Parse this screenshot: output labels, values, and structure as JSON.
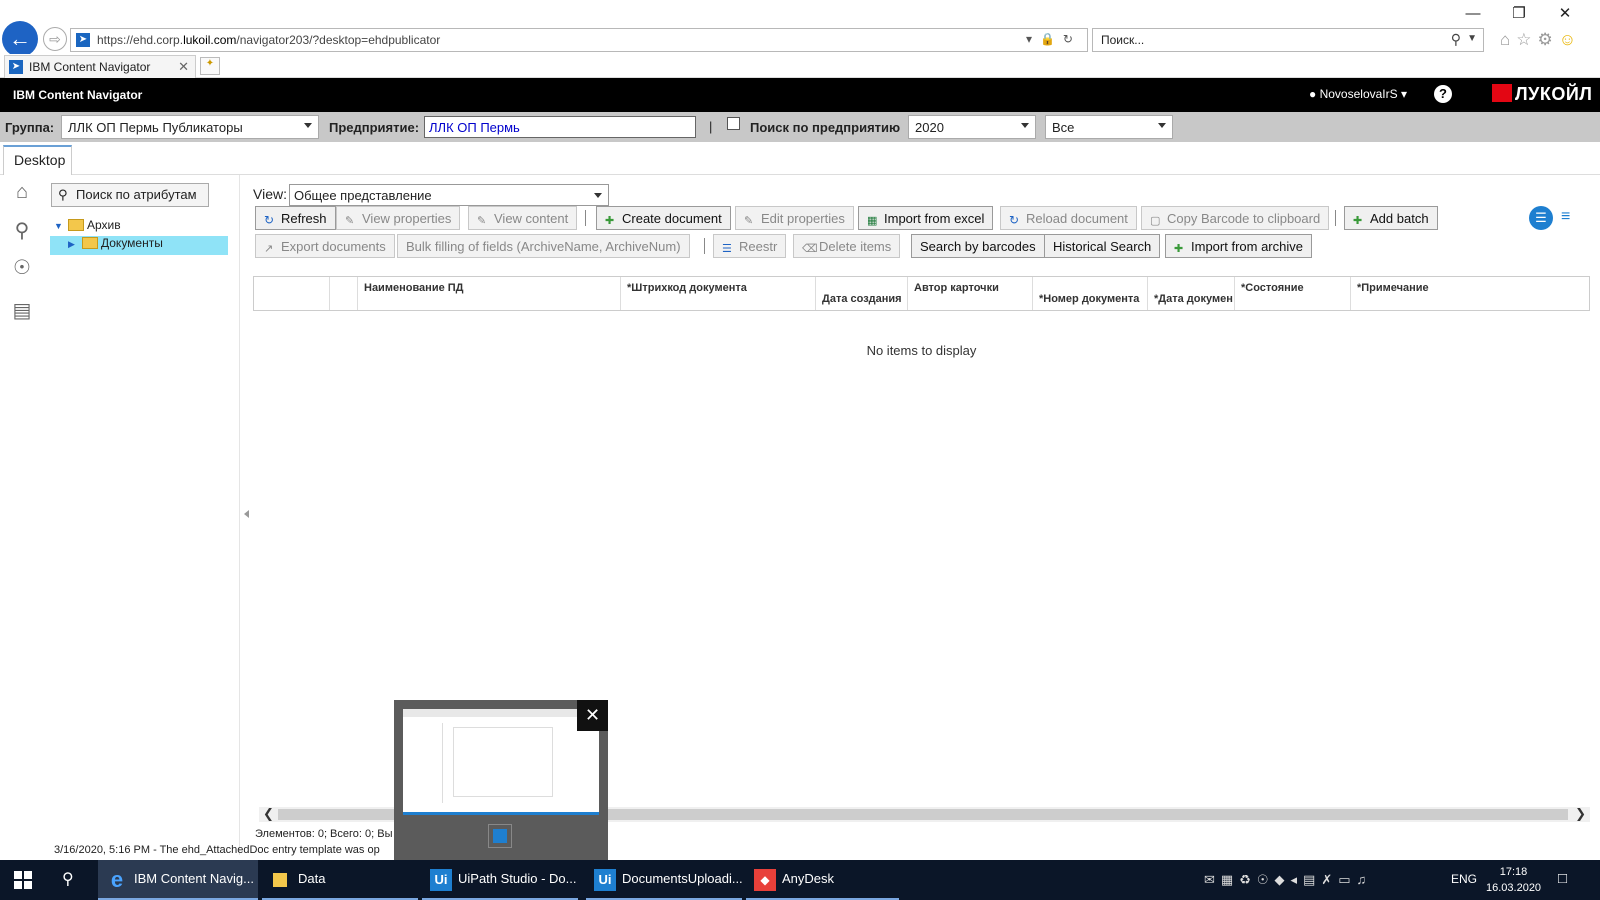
{
  "browser": {
    "url_prefix": "https://ehd.corp.",
    "url_domain": "lukoil.com",
    "url_suffix": "/navigator203/?desktop=ehdpublicator",
    "search_placeholder": "Поиск...",
    "tab_title": "IBM Content Navigator"
  },
  "header": {
    "app_title": "IBM Content Navigator",
    "user_name": "NovoselovaIrS",
    "brand": "ЛУКОЙЛ"
  },
  "filters": {
    "group_label": "Группа:",
    "group_value": "ЛЛК ОП Пермь Публикаторы",
    "enterprise_label": "Предприятие:",
    "enterprise_value": "ЛЛК ОП Пермь",
    "separator": "|",
    "enterprise_search_label": "Поиск по предприятию",
    "year_value": "2020",
    "scope_value": "Все"
  },
  "desktop_tab": "Desktop",
  "nav": {
    "attr_search": "Поиск по атрибутам",
    "tree": [
      {
        "label": "Архив"
      },
      {
        "label": "Документы"
      }
    ]
  },
  "main": {
    "view_label": "View:",
    "view_value": "Общее представление",
    "toolbar_row1": [
      {
        "label": "Refresh",
        "enabled": true
      },
      {
        "label": "View properties",
        "enabled": false
      },
      {
        "label": "View content",
        "enabled": false
      },
      {
        "label": "Create document",
        "enabled": true
      },
      {
        "label": "Edit properties",
        "enabled": false
      },
      {
        "label": "Import from excel",
        "enabled": true
      },
      {
        "label": "Reload document",
        "enabled": false
      },
      {
        "label": "Copy Barcode to clipboard",
        "enabled": false
      },
      {
        "label": "Add batch",
        "enabled": true
      }
    ],
    "toolbar_row2": [
      {
        "label": "Export documents",
        "enabled": false
      },
      {
        "label": "Bulk filling of fields (ArchiveName, ArchiveNum)",
        "enabled": false
      },
      {
        "label": "Reestr",
        "enabled": false
      },
      {
        "label": "Delete items",
        "enabled": false
      },
      {
        "label": "Search by barcodes",
        "enabled": true
      },
      {
        "label": "Historical Search",
        "enabled": true
      },
      {
        "label": "Import from archive",
        "enabled": true
      }
    ],
    "columns": [
      "",
      "",
      "Наименование ПД",
      "*Штрихкод документа",
      "Дата создания",
      "Автор карточки",
      "*Номер документа",
      "*Дата докумен",
      "*Состояние",
      "*Примечание"
    ],
    "empty_message": "No items to display",
    "status_count": "Элементов: 0; Всего: 0; Вы",
    "status_message": "3/16/2020, 5:16 PM - The ehd_AttachedDoc entry template was op"
  },
  "taskbar": {
    "items": [
      {
        "label": "IBM Content Navig...",
        "icon": "e"
      },
      {
        "label": "Data",
        "icon": "folder"
      },
      {
        "label": "UiPath Studio - Do...",
        "icon": "Ui"
      },
      {
        "label": "DocumentsUploadi...",
        "icon": "Ui"
      },
      {
        "label": "AnyDesk",
        "icon": "anydesk"
      }
    ],
    "lang": "ENG",
    "time": "17:18",
    "date": "16.03.2020"
  },
  "colors": {
    "accent": "#1e63c4",
    "header_bg": "#000000",
    "filter_bg": "#c8c8c8",
    "brand_red": "#e30613",
    "taskbar_bg": "#0b1628"
  }
}
